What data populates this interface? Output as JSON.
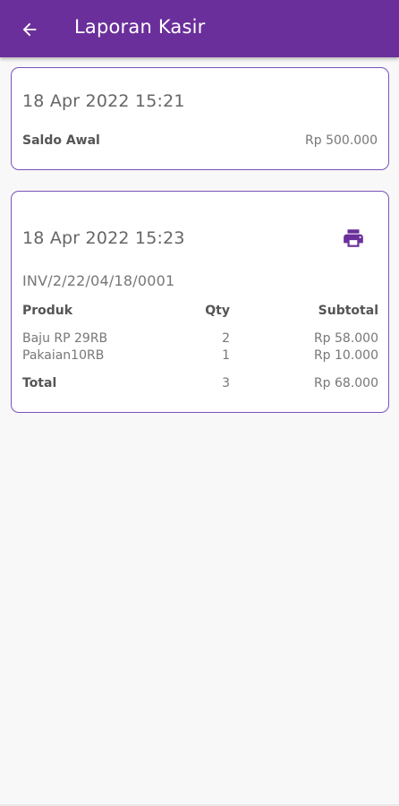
{
  "colors": {
    "appbar": "#6a2f9b",
    "card_border": "#7b52b8",
    "icon": "#6a2f9b"
  },
  "appbar": {
    "title": "Laporan Kasir",
    "back_icon": "arrow-left-icon"
  },
  "opening_card": {
    "datetime": "18 Apr 2022 15:21",
    "label": "Saldo Awal",
    "value": "Rp 500.000"
  },
  "transaction_card": {
    "datetime": "18 Apr 2022 15:23",
    "print_icon": "printer-icon",
    "invoice": "INV/2/22/04/18/0001",
    "headers": {
      "product": "Produk",
      "qty": "Qty",
      "subtotal": "Subtotal"
    },
    "items": [
      {
        "product": "Baju RP 29RB",
        "qty": "2",
        "subtotal": "Rp 58.000"
      },
      {
        "product": "Pakaian10RB",
        "qty": "1",
        "subtotal": "Rp 10.000"
      }
    ],
    "total": {
      "label": "Total",
      "qty": "3",
      "subtotal": "Rp 68.000"
    }
  }
}
